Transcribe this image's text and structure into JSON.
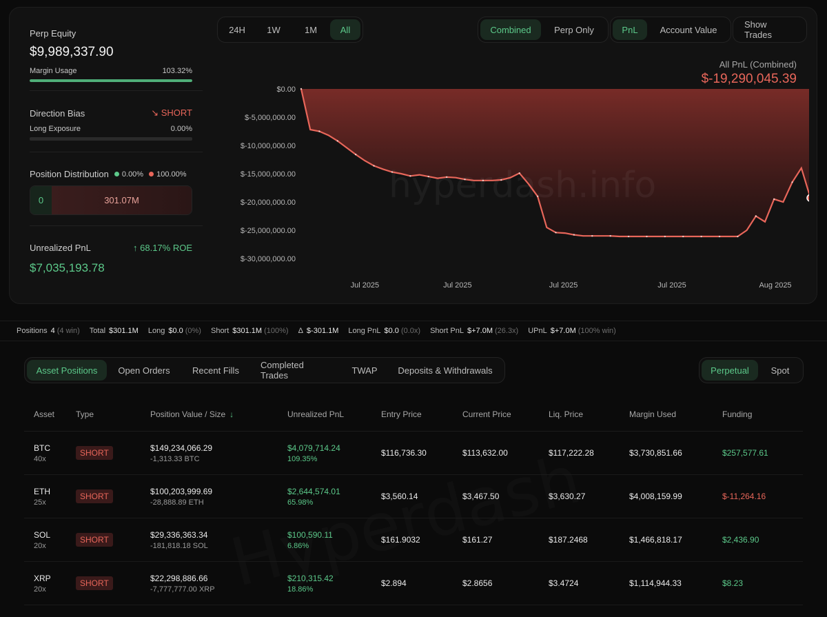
{
  "stats": {
    "perp_equity_label": "Perp Equity",
    "perp_equity_value": "$9,989,337.90",
    "margin_usage_label": "Margin Usage",
    "margin_usage_value": "103.32%",
    "margin_usage_fraction": 1.0,
    "direction_bias_label": "Direction Bias",
    "direction_bias_value": "SHORT",
    "long_exposure_label": "Long Exposure",
    "long_exposure_value": "0.00%",
    "long_exposure_fraction": 0.0,
    "position_distribution_label": "Position Distribution",
    "dist_long_pct": "0.00%",
    "dist_short_pct": "100.00%",
    "dist_long_value": "0",
    "dist_short_value": "301.07M",
    "unrealized_pnl_label": "Unrealized PnL",
    "roe": "68.17% ROE",
    "unrealized_pnl_value": "$7,035,193.78"
  },
  "timeframes": [
    "24H",
    "1W",
    "1M",
    "All"
  ],
  "active_timeframe": "All",
  "modes": [
    "Combined",
    "Perp Only"
  ],
  "active_mode": "Combined",
  "metrics": [
    "PnL",
    "Account Value"
  ],
  "active_metric": "PnL",
  "show_trades_label": "Show Trades",
  "pnl_title": "All PnL (Combined)",
  "pnl_value": "$-19,290,045.39",
  "watermark": "hyperdash.info",
  "watermark2": "Hyperdash",
  "chart_data": {
    "type": "area",
    "y_ticks": [
      "$0.00",
      "$-5,000,000.00",
      "$-10,000,000.00",
      "$-15,000,000.00",
      "$-20,000,000.00",
      "$-25,000,000.00",
      "$-30,000,000.00"
    ],
    "x_ticks": [
      "Jul 2025",
      "Jul 2025",
      "Jul 2025",
      "Jul 2025",
      "Aug 2025"
    ],
    "ylim": [
      -30000000,
      0
    ],
    "values": [
      0,
      -7200000,
      -7500000,
      -8200000,
      -9200000,
      -10400000,
      -11600000,
      -12700000,
      -13600000,
      -14200000,
      -14700000,
      -15000000,
      -15400000,
      -15200000,
      -15500000,
      -15800000,
      -15600000,
      -15700000,
      -16000000,
      -16200000,
      -16200000,
      -16200000,
      -16100000,
      -15700000,
      -14900000,
      -16800000,
      -19000000,
      -24500000,
      -25400000,
      -25500000,
      -25800000,
      -26000000,
      -26000000,
      -26000000,
      -26000000,
      -26100000,
      -26100000,
      -26100000,
      -26100000,
      -26100000,
      -26100000,
      -26100000,
      -26100000,
      -26100000,
      -26100000,
      -26100000,
      -26100000,
      -26100000,
      -26100000,
      -25000000,
      -22500000,
      -23500000,
      -19500000,
      -20000000,
      -16500000,
      -14000000,
      -19290045.39
    ],
    "grid": false
  },
  "summary": {
    "positions_label": "Positions",
    "positions_value": "4",
    "positions_note": "(4 win)",
    "total_label": "Total",
    "total_value": "$301.1M",
    "long_label": "Long",
    "long_value": "$0.0",
    "long_note": "(0%)",
    "short_label": "Short",
    "short_value": "$301.1M",
    "short_note": "(100%)",
    "delta_label": "Δ",
    "delta_value": "$-301.1M",
    "long_pnl_label": "Long PnL",
    "long_pnl_value": "$0.0",
    "long_pnl_note": "(0.0x)",
    "short_pnl_label": "Short PnL",
    "short_pnl_value": "$+7.0M",
    "short_pnl_note": "(26.3x)",
    "upnl_label": "UPnL",
    "upnl_value": "$+7.0M",
    "upnl_note": "(100% win)"
  },
  "tabs": [
    "Asset Positions",
    "Open Orders",
    "Recent Fills",
    "Completed Trades",
    "TWAP",
    "Deposits & Withdrawals"
  ],
  "active_tab": "Asset Positions",
  "market_tabs": [
    "Perpetual",
    "Spot"
  ],
  "active_market_tab": "Perpetual",
  "table": {
    "headers": [
      "Asset",
      "Type",
      "Position Value / Size",
      "Unrealized PnL",
      "Entry Price",
      "Current Price",
      "Liq. Price",
      "Margin Used",
      "Funding"
    ],
    "rows": [
      {
        "asset": "BTC",
        "lev": "40x",
        "type": "SHORT",
        "value": "$149,234,066.29",
        "size": "-1,313.33 BTC",
        "upnl": "$4,079,714.24",
        "upnl_pct": "109.35%",
        "entry": "$116,736.30",
        "current": "$113,632.00",
        "liq": "$117,222.28",
        "margin": "$3,730,851.66",
        "funding": "$257,577.61",
        "funding_color": "green"
      },
      {
        "asset": "ETH",
        "lev": "25x",
        "type": "SHORT",
        "value": "$100,203,999.69",
        "size": "-28,888.89 ETH",
        "upnl": "$2,644,574.01",
        "upnl_pct": "65.98%",
        "entry": "$3,560.14",
        "current": "$3,467.50",
        "liq": "$3,630.27",
        "margin": "$4,008,159.99",
        "funding": "$-11,264.16",
        "funding_color": "red"
      },
      {
        "asset": "SOL",
        "lev": "20x",
        "type": "SHORT",
        "value": "$29,336,363.34",
        "size": "-181,818.18 SOL",
        "upnl": "$100,590.11",
        "upnl_pct": "6.86%",
        "entry": "$161.9032",
        "current": "$161.27",
        "liq": "$187.2468",
        "margin": "$1,466,818.17",
        "funding": "$2,436.90",
        "funding_color": "green"
      },
      {
        "asset": "XRP",
        "lev": "20x",
        "type": "SHORT",
        "value": "$22,298,886.66",
        "size": "-7,777,777.00 XRP",
        "upnl": "$210,315.42",
        "upnl_pct": "18.86%",
        "entry": "$2.894",
        "current": "$2.8656",
        "liq": "$3.4724",
        "margin": "$1,114,944.33",
        "funding": "$8.23",
        "funding_color": "green"
      }
    ]
  }
}
